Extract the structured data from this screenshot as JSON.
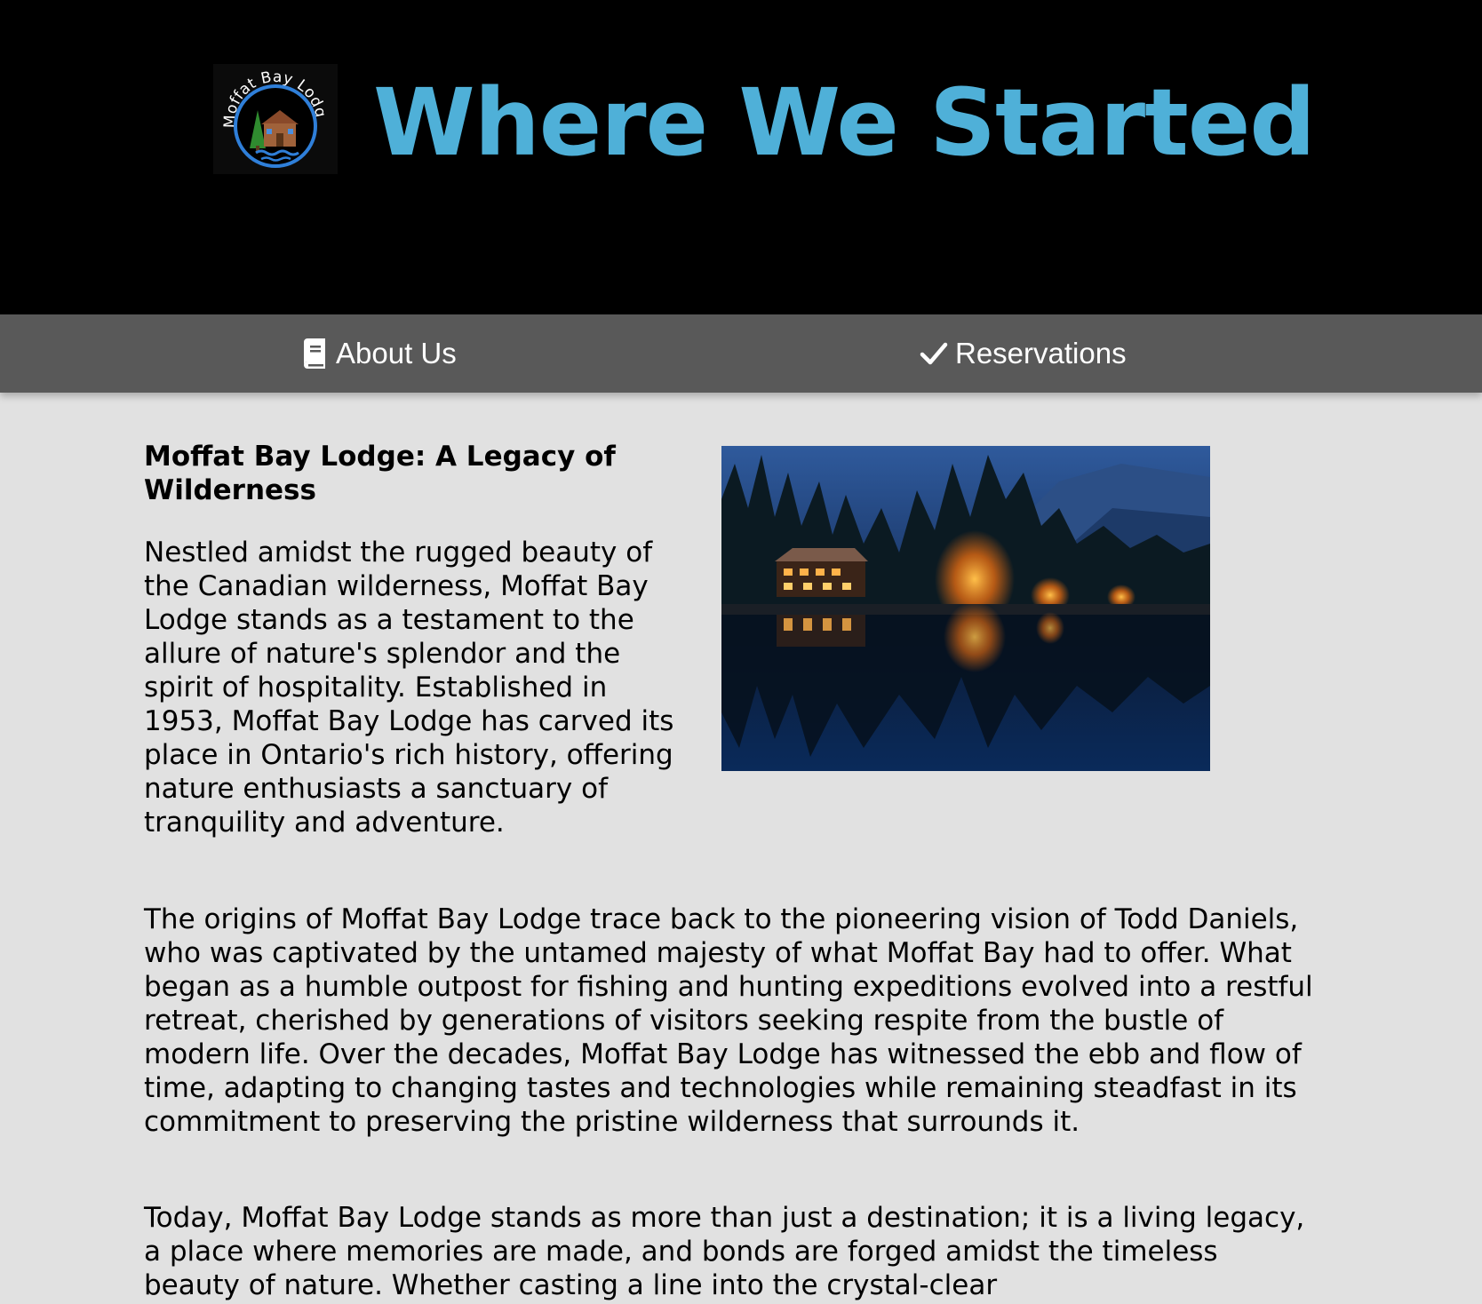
{
  "header": {
    "title": "Where We Started",
    "logo": {
      "text": "Moffat Bay Lodge",
      "icon": "lodge-logo"
    },
    "background_color": "#000000",
    "title_color": "#4fb0d8"
  },
  "nav": {
    "items": [
      {
        "label": "About Us",
        "icon": "book-icon"
      },
      {
        "label": "Reservations",
        "icon": "checkmark-icon"
      }
    ],
    "background_color": "#595959"
  },
  "main": {
    "heading": "Moffat Bay Lodge: A Legacy of Wilderness",
    "paragraphs": [
      "Nestled amidst the rugged beauty of the Canadian wilderness, Moffat Bay Lodge stands as a testament to the allure of nature's splendor and the spirit of hospitality. Established in 1953, Moffat Bay Lodge has carved its place in Ontario's rich history, offering nature enthusiasts a sanctuary of tranquility and adventure.",
      "The origins of Moffat Bay Lodge trace back to the pioneering vision of Todd Daniels, who was captivated by the untamed majesty of what Moffat Bay had to offer. What began as a humble outpost for fishing and hunting expeditions evolved into a restful retreat, cherished by generations of visitors seeking respite from the bustle of modern life. Over the decades, Moffat Bay Lodge has witnessed the ebb and flow of time, adapting to changing tastes and technologies while remaining steadfast in its commitment to preserving the pristine wilderness that surrounds it.",
      "Today, Moffat Bay Lodge stands as more than just a destination; it is a living legacy, a place where memories are made, and bonds are forged amidst the timeless beauty of nature. Whether casting a line into the crystal-clear"
    ],
    "background_color": "#e1e1e1"
  }
}
